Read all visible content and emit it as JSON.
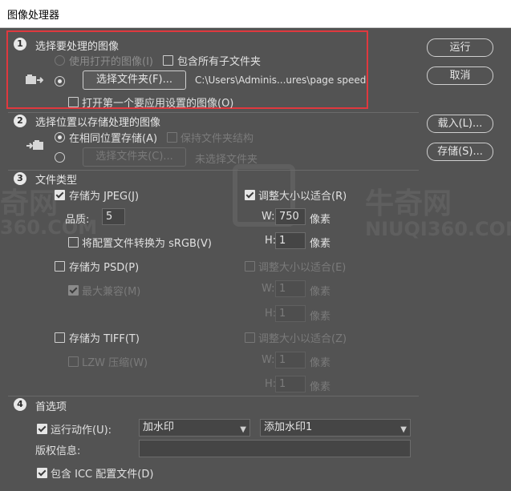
{
  "window": {
    "title": "图像处理器"
  },
  "side_buttons": {
    "run": "运行",
    "cancel": "取消",
    "load": "载入(L)...",
    "save": "存储(S)..."
  },
  "watermark": {
    "brand_left": "奇网",
    "url_left": "360.COM",
    "brand_right": "牛奇网",
    "url_right": "NIUQI360.COM"
  },
  "section1": {
    "number": "1",
    "title": "选择要处理的图像",
    "use_open": "使用打开的图像(I)",
    "include_subfolders": "包含所有子文件夹",
    "select_folder": "选择文件夹(F)...",
    "path": "C:\\Users\\Adminis...ures\\page speed",
    "open_first": "打开第一个要应用设置的图像(O)"
  },
  "section2": {
    "number": "2",
    "title": "选择位置以存储处理的图像",
    "same_location": "在相同位置存储(A)",
    "keep_structure": "保持文件夹结构",
    "select_folder": "选择文件夹(C)...",
    "no_folder": "未选择文件夹"
  },
  "section3": {
    "number": "3",
    "title": "文件类型",
    "jpeg": {
      "label": "存储为 JPEG(J)",
      "checked": true,
      "resize": "调整大小以适合(R)",
      "resize_checked": true,
      "quality_label": "品质:",
      "quality": "5",
      "w_label": "W:",
      "w": "750",
      "w_unit": "像素",
      "h_label": "H:",
      "h": "1",
      "h_unit": "像素",
      "srgb": "将配置文件转换为 sRGB(V)"
    },
    "psd": {
      "label": "存储为 PSD(P)",
      "resize": "调整大小以适合(E)",
      "max_compat": "最大兼容(M)",
      "w_label": "W:",
      "w": "1",
      "w_unit": "像素",
      "h_label": "H:",
      "h": "1",
      "h_unit": "像素"
    },
    "tiff": {
      "label": "存储为 TIFF(T)",
      "resize": "调整大小以适合(Z)",
      "lzw": "LZW 压缩(W)",
      "w_label": "W:",
      "w": "1",
      "w_unit": "像素",
      "h_label": "H:",
      "h": "1",
      "h_unit": "像素"
    }
  },
  "section4": {
    "number": "4",
    "title": "首选项",
    "run_action": "运行动作(U):",
    "action_set": "加水印",
    "action": "添加水印1",
    "copyright_label": "版权信息:",
    "copyright_value": "",
    "include_icc": "包含 ICC 配置文件(D)"
  },
  "colors": {
    "background": "#535353",
    "highlight_box": "#e0383e"
  }
}
